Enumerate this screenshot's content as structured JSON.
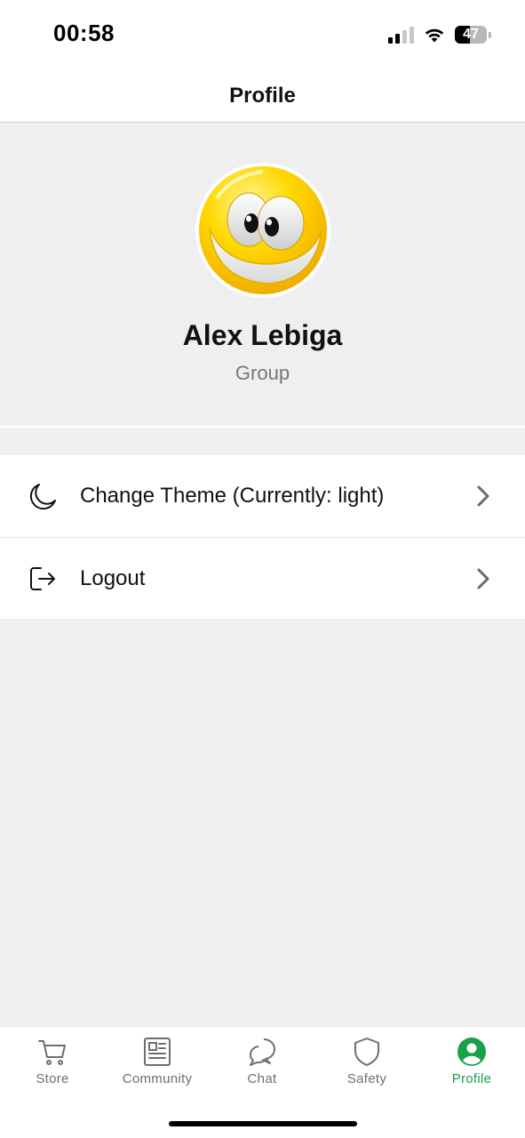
{
  "status_bar": {
    "time": "00:58",
    "battery_percent": "47",
    "battery_level": 0.47,
    "signal_bars_active": 2,
    "signal_bars_total": 4
  },
  "header": {
    "title": "Profile"
  },
  "profile": {
    "name": "Alex Lebiga",
    "group": "Group",
    "avatar_icon": "smiley-face-avatar"
  },
  "menu": {
    "items": [
      {
        "label": "Change Theme (Currently: light)",
        "icon": "moon-icon"
      },
      {
        "label": "Logout",
        "icon": "logout-icon"
      }
    ]
  },
  "tab_bar": {
    "tabs": [
      {
        "label": "Store",
        "icon": "cart-icon",
        "active": false
      },
      {
        "label": "Community",
        "icon": "newspaper-icon",
        "active": false
      },
      {
        "label": "Chat",
        "icon": "chat-bubbles-icon",
        "active": false
      },
      {
        "label": "Safety",
        "icon": "shield-icon",
        "active": false
      },
      {
        "label": "Profile",
        "icon": "person-circle-icon",
        "active": true
      }
    ]
  },
  "colors": {
    "accent": "#1aa04a",
    "inactive_tab": "#6e6e6e",
    "background": "#f0f0f0",
    "surface": "#ffffff",
    "secondary_text": "#777777"
  }
}
